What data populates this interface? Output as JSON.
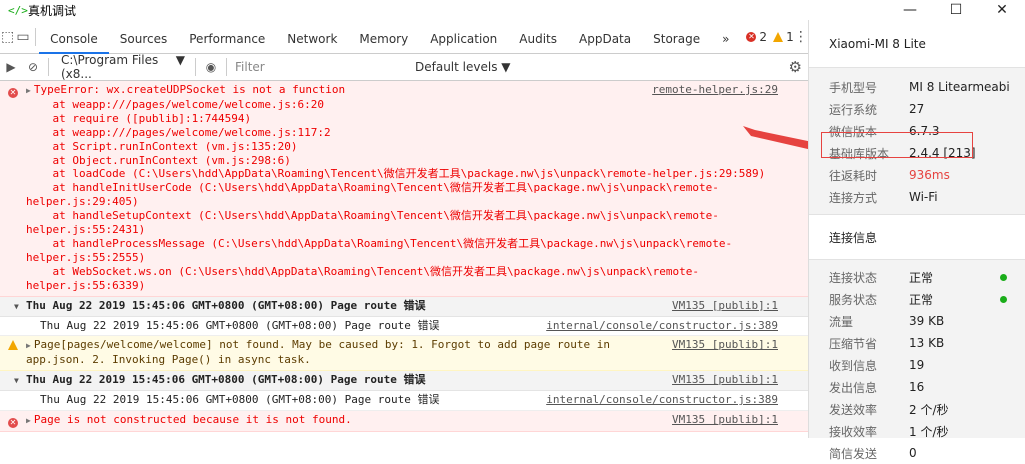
{
  "window": {
    "title": "真机调试",
    "icon": "</>",
    "min": "—",
    "max": "☐",
    "close": "✕"
  },
  "toolbar": {
    "tabs": [
      "Console",
      "Sources",
      "Performance",
      "Network",
      "Memory",
      "Application",
      "Audits",
      "AppData",
      "Storage"
    ],
    "active": "Console",
    "more": "»",
    "errors": "2",
    "warnings": "1",
    "menu": "⋮"
  },
  "filterbar": {
    "context": "C:\\Program Files (x8...",
    "context_arrow": "▼",
    "filter_placeholder": "Filter",
    "levels": "Default levels ▼"
  },
  "console": {
    "error1": {
      "message": "TypeError: wx.createUDPSocket is not a function",
      "source": "remote-helper.js:29",
      "stack": [
        "    at weapp:///pages/welcome/welcome.js:6:20",
        "    at require ([publib]:1:744594)",
        "    at weapp:///pages/welcome/welcome.js:117:2",
        "    at Script.runInContext (vm.js:135:20)",
        "    at Object.runInContext (vm.js:298:6)",
        "    at loadCode (C:\\Users\\hdd\\AppData\\Roaming\\Tencent\\微信开发者工具\\package.nw\\js\\unpack\\remote-helper.js:29:589)",
        "    at handleInitUserCode (C:\\Users\\hdd\\AppData\\Roaming\\Tencent\\微信开发者工具\\package.nw\\js\\unpack\\remote-",
        "helper.js:29:405)",
        "    at handleSetupContext (C:\\Users\\hdd\\AppData\\Roaming\\Tencent\\微信开发者工具\\package.nw\\js\\unpack\\remote-",
        "helper.js:55:2431)",
        "    at handleProcessMessage (C:\\Users\\hdd\\AppData\\Roaming\\Tencent\\微信开发者工具\\package.nw\\js\\unpack\\remote-",
        "helper.js:55:2555)",
        "    at WebSocket.ws.on (C:\\Users\\hdd\\AppData\\Roaming\\Tencent\\微信开发者工具\\package.nw\\js\\unpack\\remote-",
        "helper.js:55:6339)"
      ]
    },
    "group1": {
      "text": "Thu Aug 22 2019 15:45:06 GMT+0800 (GMT+08:00) Page route 错误",
      "source": "VM135 [publib]:1"
    },
    "plain1": {
      "text": "Thu Aug 22 2019 15:45:06 GMT+0800 (GMT+08:00) Page route 错误",
      "source": "internal/console/constructor.js:389"
    },
    "warn1": {
      "line1": "Page[pages/welcome/welcome] not found. May be caused by: 1. Forgot to add page route in",
      "line2": "app.json. 2. Invoking Page() in async task.",
      "source": "VM135 [publib]:1"
    },
    "group2": {
      "text": "Thu Aug 22 2019 15:45:06 GMT+0800 (GMT+08:00) Page route 错误",
      "source": "VM135 [publib]:1"
    },
    "plain2": {
      "text": "Thu Aug 22 2019 15:45:06 GMT+0800 (GMT+08:00) Page route 错误",
      "source": "internal/console/constructor.js:389"
    },
    "error2": {
      "message": "Page is not constructed because it is not found.",
      "source": "VM135 [publib]:1"
    }
  },
  "device": {
    "name": "Xiaomi-MI 8 Lite",
    "info": [
      {
        "k": "手机型号",
        "v": "MI 8 Litearmeabi..."
      },
      {
        "k": "运行系统",
        "v": "27"
      },
      {
        "k": "微信版本",
        "v": "6.7.3"
      },
      {
        "k": "基础库版本",
        "v": "2.4.4 [213]"
      },
      {
        "k": "往返耗时",
        "v": "936ms"
      },
      {
        "k": "连接方式",
        "v": "Wi-Fi"
      }
    ],
    "conn_title": "连接信息",
    "conn": [
      {
        "k": "连接状态",
        "v": "正常"
      },
      {
        "k": "服务状态",
        "v": "正常"
      },
      {
        "k": "流量",
        "v": "39 KB"
      },
      {
        "k": "压缩节省",
        "v": "13 KB"
      },
      {
        "k": "收到信息",
        "v": "19"
      },
      {
        "k": "发出信息",
        "v": "16"
      },
      {
        "k": "发送效率",
        "v": "2 个/秒"
      },
      {
        "k": "接收效率",
        "v": "1 个/秒"
      },
      {
        "k": "简信发送",
        "v": "0"
      }
    ],
    "highlight_color": "#e64340",
    "status_color": "#1aad19"
  }
}
